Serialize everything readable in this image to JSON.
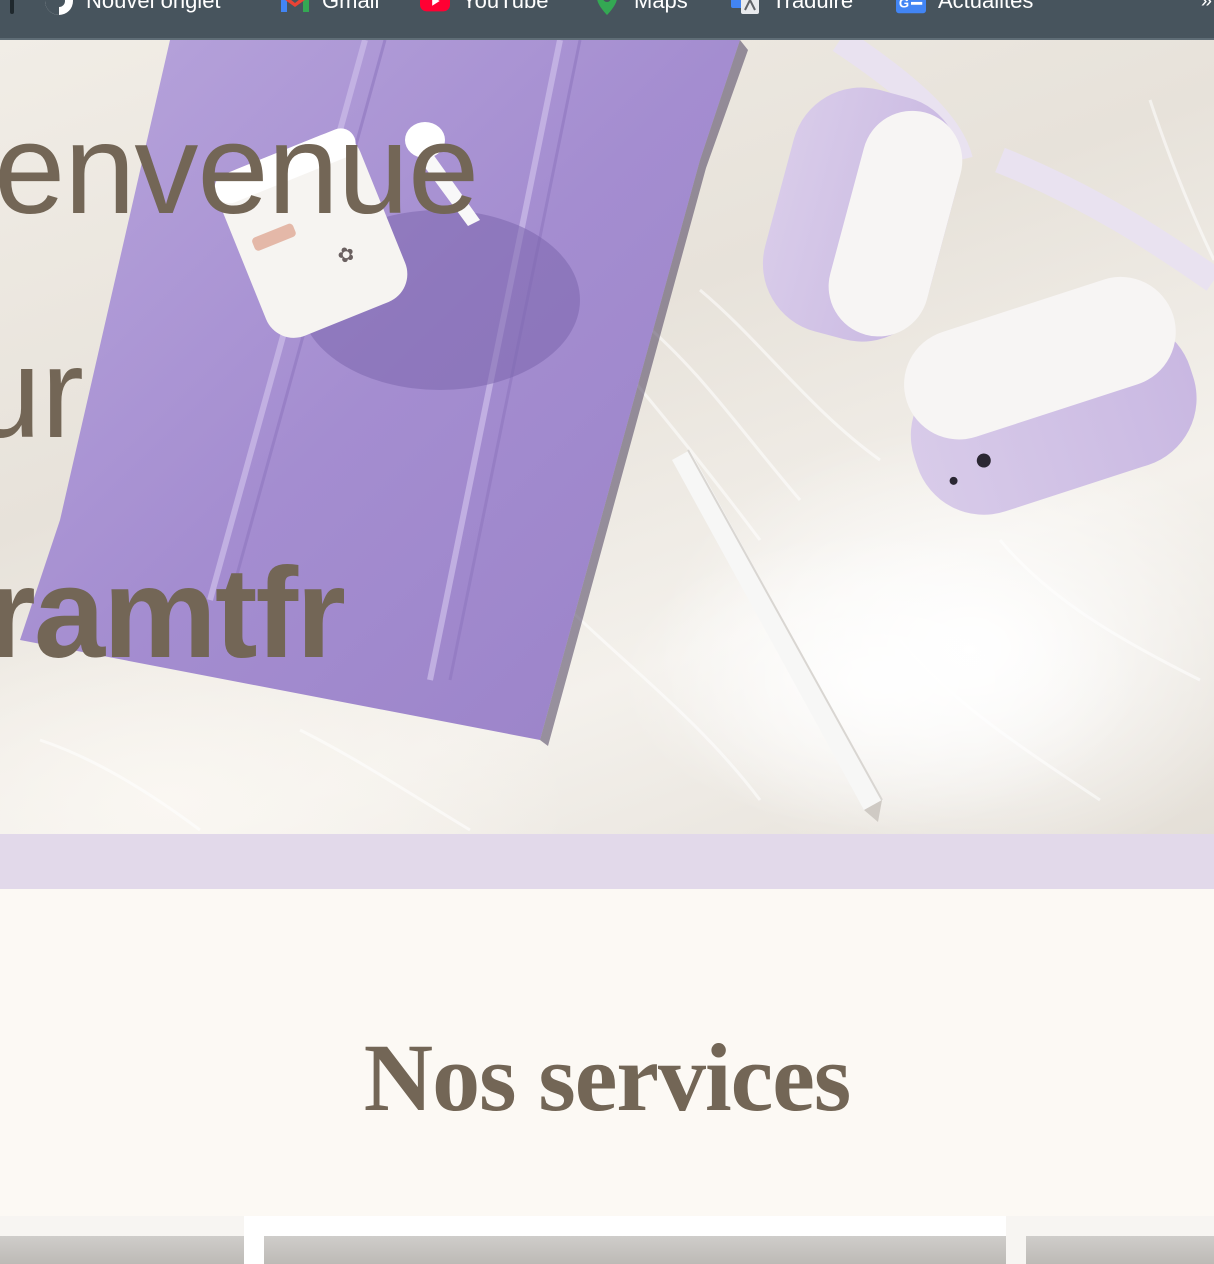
{
  "bookmarks": {
    "items": [
      {
        "label": "Nouvel onglet",
        "icon": "new-tab-icon"
      },
      {
        "label": "Gmail",
        "icon": "gmail-icon"
      },
      {
        "label": "YouTube",
        "icon": "youtube-icon"
      },
      {
        "label": "Maps",
        "icon": "maps-icon"
      },
      {
        "label": "Traduire",
        "icon": "translate-icon"
      },
      {
        "label": "Actualités",
        "icon": "news-icon"
      }
    ]
  },
  "hero": {
    "line1": "envenue",
    "line2": "ur",
    "line3": "ramtfr",
    "text_color": "#736656"
  },
  "services": {
    "title": "Nos services"
  },
  "colors": {
    "bookmarks_bg": "#47545d",
    "band": "#e2d9ea",
    "page_bg": "#fcf9f4",
    "ipad": "#a58fd0"
  }
}
